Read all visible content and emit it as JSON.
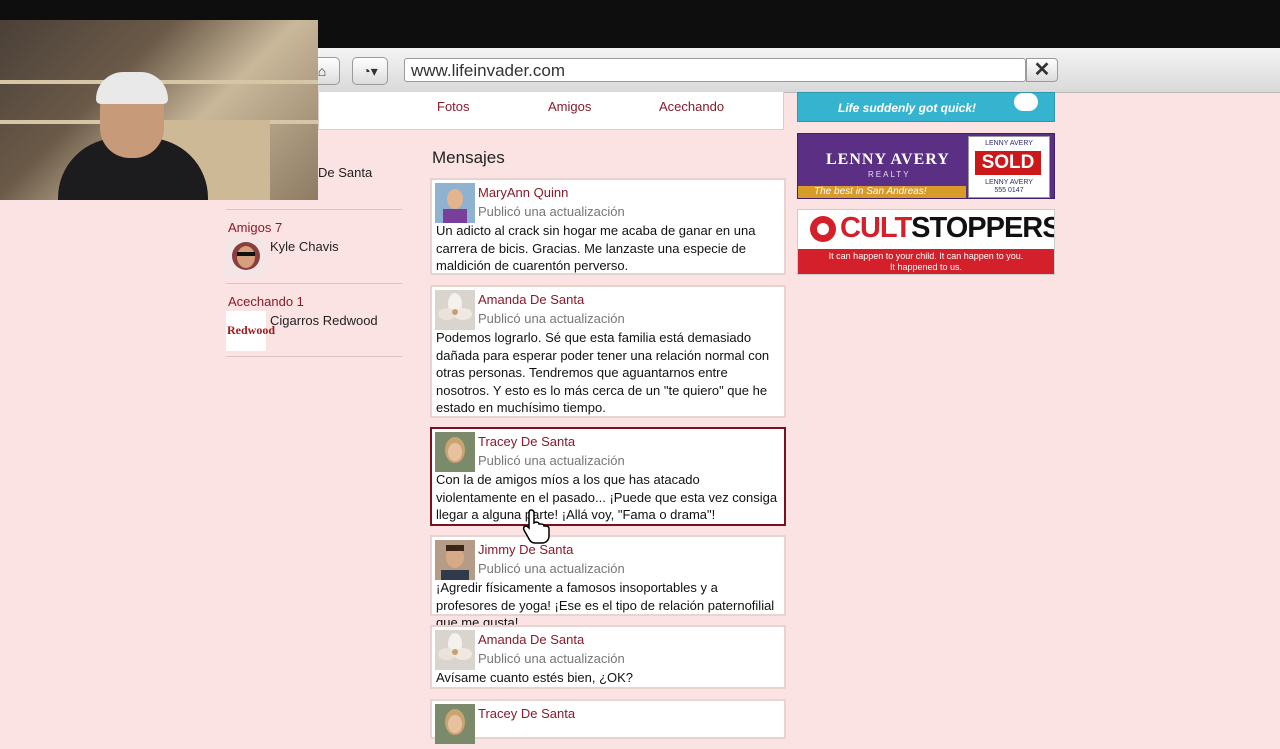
{
  "browser": {
    "url": "www.lifeinvader.com",
    "close_glyph": "✕",
    "home_glyph": "⌂",
    "history_glyph": "◔▾"
  },
  "profile_tabs": [
    {
      "label": "Fotos"
    },
    {
      "label": "Amigos"
    },
    {
      "label": "Acechando"
    }
  ],
  "sidebar": {
    "profile_name_fragment": "De Santa",
    "friends_heading": "Amigos 7",
    "friend_name": "Kyle Chavis",
    "stalking_heading": "Acechando 1",
    "stalking_name": "Cigarros Redwood",
    "redwood_logo_text": "Redwood"
  },
  "messages": {
    "title": "Mensajes",
    "posts": [
      {
        "author": "MaryAnn Quinn",
        "subtitle": "Publicó una actualización",
        "body": "Un adicto al crack sin hogar me acaba de ganar en una carrera de bicis. Gracias. Me lanzaste una especie de maldición de cuarentón perverso."
      },
      {
        "author": "Amanda De Santa",
        "subtitle": "Publicó una actualización",
        "body": "Podemos lograrlo. Sé que esta familia está demasiado dañada para esperar poder tener una relación normal con otras personas. Tendremos que aguantarnos entre nosotros. Y esto es lo más cerca de un \"te quiero\" que he estado en muchísimo tiempo."
      },
      {
        "author": "Tracey De Santa",
        "subtitle": "Publicó una actualización",
        "body": "Con la de amigos míos a los que has atacado violentamente en el pasado... ¡Puede que esta vez consiga llegar a alguna parte! ¡Allá voy, \"Fama o drama\"!"
      },
      {
        "author": "Jimmy De Santa",
        "subtitle": "Publicó una actualización",
        "body": "¡Agredir físicamente a famosos insoportables y a profesores de yoga! ¡Ese es el tipo de relación paternofilial que me gusta!"
      },
      {
        "author": "Amanda De Santa",
        "subtitle": "Publicó una actualización",
        "body": "Avísame cuanto estés bien, ¿OK?"
      },
      {
        "author": "Tracey De Santa",
        "subtitle": "",
        "body": ""
      }
    ]
  },
  "ads": {
    "top_tagline": "Life suddenly got quick!",
    "lenny": {
      "brand": "LENNY AVERY",
      "realty": "REALTY",
      "slogan": "The best in San Andreas!",
      "sign_top": "LENNY AVERY",
      "sold": "SOLD",
      "sign_name": "LENNY AVERY",
      "sign_phone": "555 0147"
    },
    "cult": {
      "brand_part1": "CULT",
      "brand_part2": "STOPPERS",
      "line1": "It can happen to your child. It can happen to you.",
      "line2": "It happened to us."
    }
  }
}
